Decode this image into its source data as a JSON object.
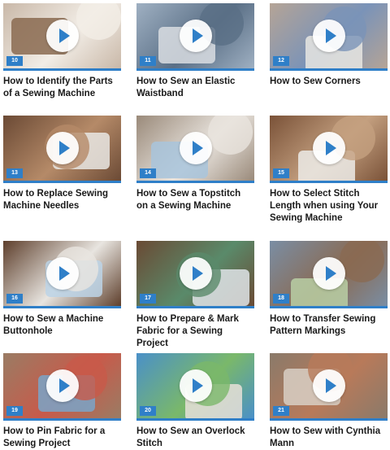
{
  "colors": {
    "accent": "#2f7fc8",
    "text": "#1a1a1a",
    "background": "#ffffff"
  },
  "videos": [
    {
      "number": "10",
      "title": "How to Identify the Parts of a Sewing Machine",
      "thumb": [
        "#c9b8a8",
        "#8a6a50",
        "#f2ede6"
      ]
    },
    {
      "number": "11",
      "title": "How to Sew an Elastic Waistband",
      "thumb": [
        "#9fb0c2",
        "#d9dde2",
        "#5a6f86"
      ]
    },
    {
      "number": "12",
      "title": "How to Sew Corners",
      "thumb": [
        "#b5a496",
        "#e8e6e2",
        "#7a93b8"
      ]
    },
    {
      "number": "13",
      "title": "How to Replace Sewing Machine Needles",
      "thumb": [
        "#6b4a35",
        "#e9e7e4",
        "#b58a68"
      ]
    },
    {
      "number": "14",
      "title": "How to Sew a Topstitch on a Sewing Machine",
      "thumb": [
        "#9a8a7a",
        "#a8c4dc",
        "#e8e3dd"
      ]
    },
    {
      "number": "15",
      "title": "How to Select Stitch Length when using Your Sewing Machine",
      "thumb": [
        "#7a5238",
        "#ecebe8",
        "#c4a080"
      ]
    },
    {
      "number": "16",
      "title": "How to Sew a Machine Buttonhole",
      "thumb": [
        "#5e3f2c",
        "#bcd4e6",
        "#e8e5e0"
      ]
    },
    {
      "number": "17",
      "title": "How to Prepare & Mark Fabric for a Sewing Project",
      "thumb": [
        "#6a4a34",
        "#dfe4e8",
        "#5a8a6a"
      ]
    },
    {
      "number": "18",
      "title": "How to Transfer Sewing Pattern Markings",
      "thumb": [
        "#7a8ea4",
        "#b8cfa4",
        "#8a6a52"
      ]
    },
    {
      "number": "19",
      "title": "How to Pin Fabric for a Sewing Project",
      "thumb": [
        "#9a7c64",
        "#7aa4c8",
        "#c85a4a"
      ]
    },
    {
      "number": "20",
      "title": "How to Sew an Overlock Stitch",
      "thumb": [
        "#4a90c8",
        "#e8e0d8",
        "#7ab86a"
      ]
    },
    {
      "number": "21",
      "title": "How to Sew with Cynthia Mann",
      "thumb": [
        "#8a7a6a",
        "#d8cfc4",
        "#b87a5a"
      ]
    }
  ]
}
